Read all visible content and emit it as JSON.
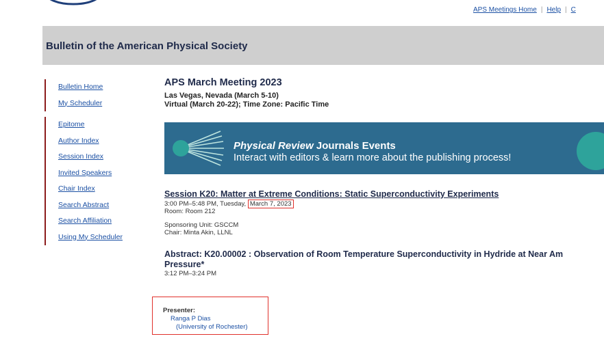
{
  "nav": {
    "meetings_home": "APS Meetings Home",
    "help": "Help",
    "contact": "C"
  },
  "header": {
    "title": "Bulletin of the American Physical Society"
  },
  "sidebar": {
    "group1": [
      {
        "label": "Bulletin Home"
      },
      {
        "label": "My Scheduler"
      }
    ],
    "group2": [
      {
        "label": "Epitome"
      },
      {
        "label": "Author Index"
      },
      {
        "label": "Session Index"
      },
      {
        "label": "Invited Speakers"
      },
      {
        "label": "Chair Index"
      },
      {
        "label": "Search Abstract"
      },
      {
        "label": "Search Affiliation"
      },
      {
        "label": "Using My Scheduler"
      }
    ]
  },
  "meeting": {
    "title": "APS March Meeting 2023",
    "location": "Las Vegas, Nevada (March 5-10)",
    "virtual": "Virtual (March 20-22); Time Zone: Pacific Time"
  },
  "banner": {
    "line1_italic": "Physical Review",
    "line1_rest": " Journals Events",
    "line2": "Interact with editors & learn more about the publishing process!"
  },
  "session": {
    "title": "Session K20: Matter at Extreme Conditions: Static Superconductivity Experiments",
    "time": "3:00 PM–5:48 PM, Tuesday,",
    "date": "March 7, 2023",
    "room": "Room: Room 212",
    "sponsor": "Sponsoring Unit: GSCCM",
    "chair": "Chair: Minta Akin, LLNL"
  },
  "abstract": {
    "title_line1": "Abstract: K20.00002 : Observation of Room Temperature Superconductivity in Hydride at Near Am",
    "title_line2": "Pressure*",
    "time": "3:12 PM–3:24 PM"
  },
  "presenter": {
    "label": "Presenter:",
    "name": "Ranga P Dias",
    "affiliation": "(University of Rochester)"
  }
}
